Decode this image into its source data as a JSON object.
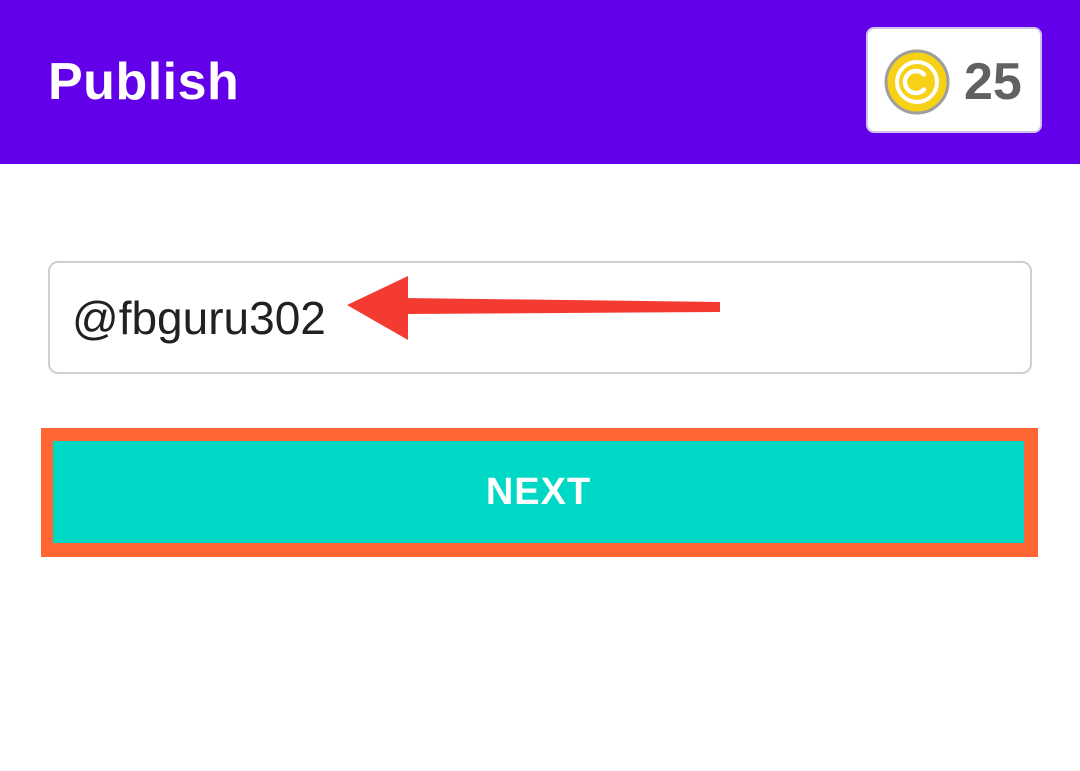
{
  "app_bar": {
    "title": "Publish",
    "background_color": "#6200ea",
    "coins": {
      "icon": "copyright-coin-icon",
      "count": "25",
      "coin_color": "#f7d116"
    }
  },
  "form": {
    "username_value": "@fbguru302",
    "next_label": "NEXT",
    "button_color": "#00d8c6"
  },
  "annotations": {
    "arrow_color": "#f33b32",
    "highlight_color": "#ff6633"
  }
}
